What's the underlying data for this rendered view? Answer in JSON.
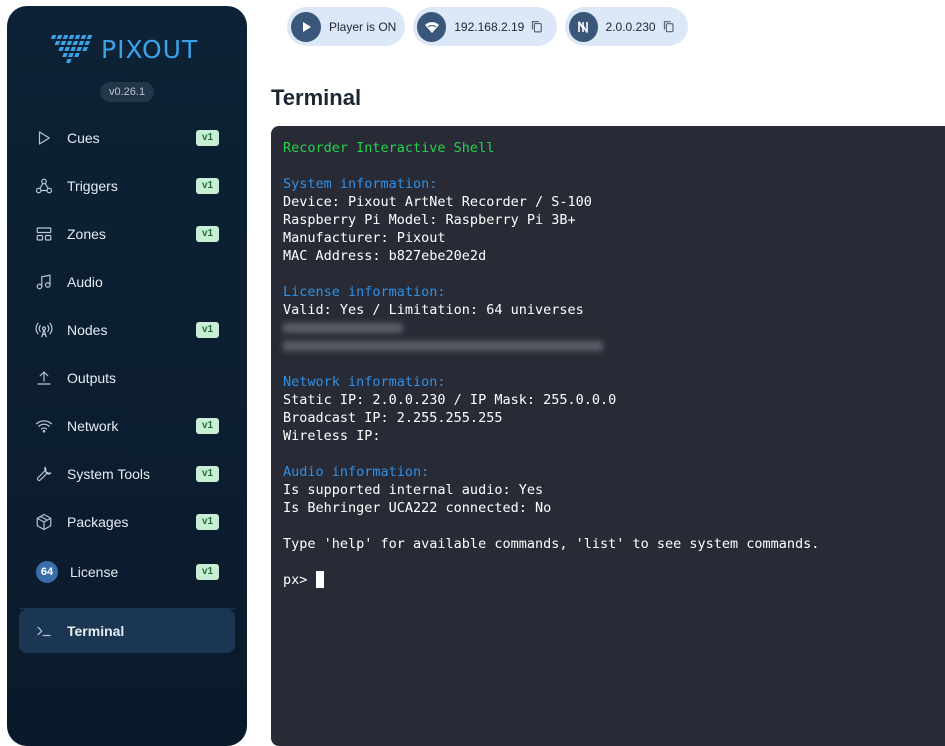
{
  "brand": {
    "name": "PIXOUT",
    "version": "v0.26.1"
  },
  "sidebar": {
    "items": [
      {
        "label": "Cues",
        "badge": "v1",
        "icon": "play-icon"
      },
      {
        "label": "Triggers",
        "badge": "v1",
        "icon": "webhook-icon"
      },
      {
        "label": "Zones",
        "badge": "v1",
        "icon": "layout-icon"
      },
      {
        "label": "Audio",
        "badge": "",
        "icon": "music-icon"
      },
      {
        "label": "Nodes",
        "badge": "v1",
        "icon": "broadcast-icon"
      },
      {
        "label": "Outputs",
        "badge": "",
        "icon": "upload-icon"
      },
      {
        "label": "Network",
        "badge": "v1",
        "icon": "wifi-icon"
      },
      {
        "label": "System Tools",
        "badge": "v1",
        "icon": "wrench-icon"
      },
      {
        "label": "Packages",
        "badge": "v1",
        "icon": "package-icon"
      },
      {
        "label": "License",
        "badge": "v1",
        "icon": "license-icon",
        "count": "64"
      },
      {
        "label": "Terminal",
        "badge": "",
        "icon": "terminal-icon"
      }
    ]
  },
  "header": {
    "player_status": "Player is ON",
    "wifi_ip": "192.168.2.19",
    "artnet_ip": "2.0.0.230"
  },
  "main": {
    "title": "Terminal"
  },
  "terminal": {
    "shell_title": "Recorder Interactive Shell",
    "system_heading": "System information:",
    "device": "Device: Pixout ArtNet Recorder / S-100",
    "rpi_model": "Raspberry Pi Model: Raspberry Pi 3B+",
    "manufacturer": "Manufacturer: Pixout",
    "mac": "MAC Address: b827ebe20e2d",
    "license_heading": "License information:",
    "license_valid": "Valid: Yes / Limitation: 64 universes",
    "network_heading": "Network information:",
    "static_ip": "Static IP: 2.0.0.230 / IP Mask: 255.0.0.0",
    "broadcast_ip": "Broadcast IP: 2.255.255.255",
    "wireless_ip": "Wireless IP:",
    "audio_heading": "Audio information:",
    "audio_internal": "Is supported internal audio: Yes",
    "audio_behringer": "Is Behringer UCA222 connected: No",
    "help_text": "Type 'help' for available commands, 'list' to see system commands.",
    "prompt": "px> "
  },
  "colors": {
    "accent": "#3aa3e8",
    "sidebar_bg": "#0d2236",
    "terminal_bg": "#282b35",
    "green": "#24d24b",
    "blue": "#2f8fe6"
  }
}
